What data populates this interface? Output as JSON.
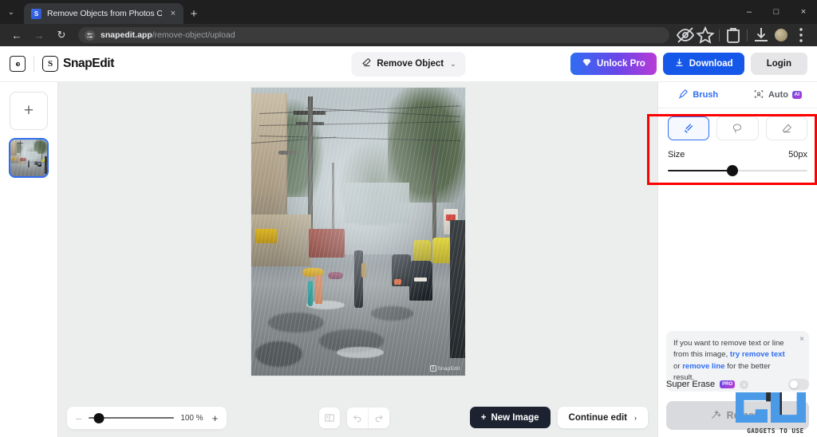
{
  "browser": {
    "tab": {
      "title": "Remove Objects from Photos O",
      "close_label": "×"
    },
    "new_tab_label": "+",
    "tab_search_label": "⌄",
    "nav": {
      "back": "←",
      "forward": "→",
      "reload": "↻"
    },
    "omnibox": {
      "domain": "snapedit.app",
      "path": "/remove-object/upload",
      "site_settings_icon": "tune-icon"
    },
    "toolbar_icons": [
      "eye-off-icon",
      "star-icon",
      "extensions-icon",
      "downloads-icon",
      "profile-avatar",
      "chrome-menu-icon"
    ],
    "window_controls": {
      "minimize": "–",
      "maximize": "□",
      "close": "×"
    }
  },
  "header": {
    "home_icon": "home-icon",
    "logo_mark": "S",
    "logo_text": "SnapEdit",
    "mode": {
      "icon": "eraser-icon",
      "label": "Remove Object",
      "chevron": "⌄"
    },
    "unlock_pro": {
      "label": "Unlock Pro",
      "icon": "diamond-icon"
    },
    "download": {
      "label": "Download",
      "icon": "download-icon"
    },
    "login": {
      "label": "Login"
    }
  },
  "sidebar": {
    "add_label": "+",
    "thumbnails": [
      {
        "name": "rainy-street-photo",
        "selected": true
      }
    ]
  },
  "canvas": {
    "image_name": "rainy-street-scene",
    "watermark": "SnapEdit"
  },
  "right_panel": {
    "tabs": [
      {
        "id": "brush",
        "label": "Brush",
        "icon": "brush-icon",
        "active": true
      },
      {
        "id": "auto",
        "label": "Auto",
        "icon": "auto-select-icon",
        "badge": "AI",
        "active": false
      }
    ],
    "tools": [
      {
        "id": "brush",
        "name": "brush-tool",
        "active": true
      },
      {
        "id": "lasso",
        "name": "lasso-tool",
        "active": false
      },
      {
        "id": "eraser",
        "name": "eraser-tool",
        "active": false
      }
    ],
    "size": {
      "label": "Size",
      "value": "50px",
      "percent": 46
    },
    "hint": {
      "lead": "If you want to remove text or line from this image,",
      "link1": "try remove text",
      "mid": "or",
      "link2": "remove line",
      "tail": "for the better result.",
      "close": "×"
    },
    "super_erase": {
      "label": "Super Erase",
      "badge": "PRO",
      "info": "i",
      "enabled": false
    },
    "remove_button": {
      "label": "Remove",
      "icon": "magic-wand-icon",
      "disabled": true
    }
  },
  "bottom_bar": {
    "zoom": {
      "minus": "–",
      "plus": "+",
      "value": "100 %",
      "percent": 12
    },
    "compare_icon": "split-compare-icon",
    "undo_icon": "undo-icon",
    "redo_icon": "redo-icon",
    "new_image": {
      "label": "New Image",
      "icon": "plus-icon"
    },
    "continue_edit": {
      "label": "Continue edit",
      "chevron": "›"
    }
  },
  "annotation": {
    "highlight": "red-rectangle-brush-size-controls",
    "color": "#ff0000"
  },
  "overlay_watermark": {
    "text": "GADGETS TO USE"
  }
}
